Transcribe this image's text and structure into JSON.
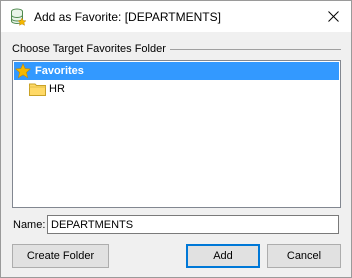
{
  "window": {
    "title": "Add as Favorite: [DEPARTMENTS]",
    "icon": "database-favorite-icon",
    "close_icon": "close-icon"
  },
  "group": {
    "label": "Choose Target Favorites Folder"
  },
  "tree": {
    "items": [
      {
        "label": "Favorites",
        "icon": "star-icon",
        "selected": true,
        "level": 0
      },
      {
        "label": "HR",
        "icon": "folder-icon",
        "selected": false,
        "level": 1
      }
    ],
    "selection_color": "#3399ff",
    "star_color": "#f5b800",
    "folder_color": "#ffd966"
  },
  "name": {
    "label": "Name:",
    "value": "DEPARTMENTS"
  },
  "buttons": {
    "create_folder": "Create Folder",
    "add": "Add",
    "cancel": "Cancel"
  }
}
